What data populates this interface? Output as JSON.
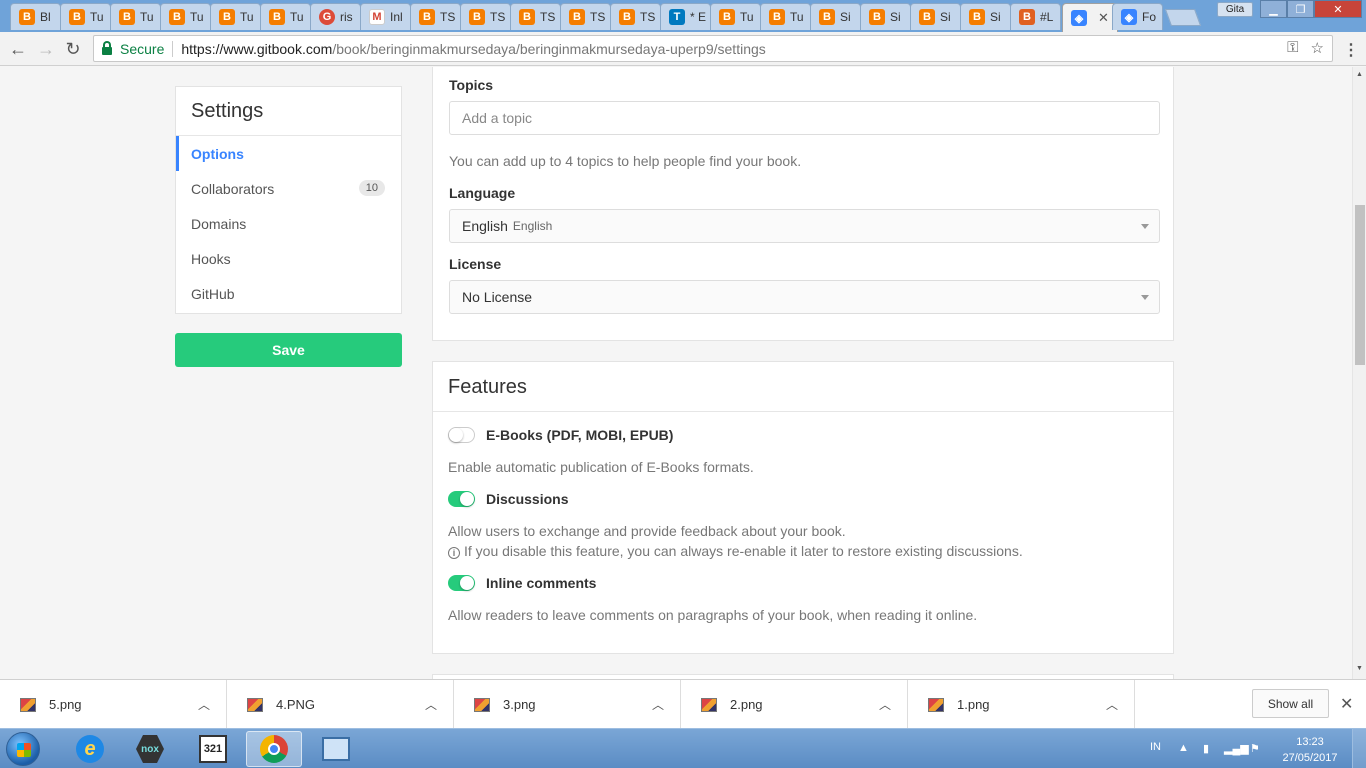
{
  "browser": {
    "tabs": [
      {
        "label": "Bl",
        "icon": "blogger-icon"
      },
      {
        "label": "Tu",
        "icon": "blogger-icon"
      },
      {
        "label": "Tu",
        "icon": "blogger-icon"
      },
      {
        "label": "Tu",
        "icon": "blogger-icon"
      },
      {
        "label": "Tu",
        "icon": "blogger-icon"
      },
      {
        "label": "Tu",
        "icon": "blogger-icon"
      },
      {
        "label": "ris",
        "icon": "google-plus-icon"
      },
      {
        "label": "Inl",
        "icon": "gmail-icon"
      },
      {
        "label": "TS",
        "icon": "blogger-icon"
      },
      {
        "label": "TS",
        "icon": "blogger-icon"
      },
      {
        "label": "TS",
        "icon": "blogger-icon"
      },
      {
        "label": "TS",
        "icon": "blogger-icon"
      },
      {
        "label": "TS",
        "icon": "blogger-icon"
      },
      {
        "label": "* E",
        "icon": "trello-icon"
      },
      {
        "label": "Tu",
        "icon": "blogger-icon"
      },
      {
        "label": "Tu",
        "icon": "blogger-icon"
      },
      {
        "label": "Si",
        "icon": "blogger-icon"
      },
      {
        "label": "Si",
        "icon": "blogger-icon"
      },
      {
        "label": "Si",
        "icon": "blogger-icon"
      },
      {
        "label": "Si",
        "icon": "blogger-icon"
      },
      {
        "label": "#L",
        "icon": "blogger-icon"
      },
      {
        "label": "",
        "icon": "gitbook-icon",
        "active": true
      },
      {
        "label": "Fo",
        "icon": "gitbook-icon"
      }
    ],
    "profile_name": "Gita",
    "secure_label": "Secure",
    "url_host": "https://www.gitbook.com",
    "url_path": "/book/beringinmakmursedaya/beringinmakmursedaya-uperp9/settings"
  },
  "sidebar": {
    "title": "Settings",
    "items": [
      {
        "label": "Options",
        "active": true
      },
      {
        "label": "Collaborators",
        "badge": "10"
      },
      {
        "label": "Domains"
      },
      {
        "label": "Hooks"
      },
      {
        "label": "GitHub"
      }
    ],
    "save_label": "Save"
  },
  "general": {
    "topics_label": "Topics",
    "topics_placeholder": "Add a topic",
    "topics_help": "You can add up to 4 topics to help people find your book.",
    "language_label": "Language",
    "language_value": "English",
    "language_native": "English",
    "license_label": "License",
    "license_value": "No License"
  },
  "features": {
    "title": "Features",
    "items": [
      {
        "label": "E-Books (PDF, MOBI, EPUB)",
        "enabled": false,
        "desc": "Enable automatic publication of E-Books formats."
      },
      {
        "label": "Discussions",
        "enabled": true,
        "desc": "Allow users to exchange and provide feedback about your book.",
        "note": "If you disable this feature, you can always re-enable it later to restore existing discussions."
      },
      {
        "label": "Inline comments",
        "enabled": true,
        "desc": "Allow readers to leave comments on paragraphs of your book, when reading it online."
      }
    ]
  },
  "downloads": {
    "items": [
      "5.png",
      "4.PNG",
      "3.png",
      "2.png",
      "1.png"
    ],
    "show_all_label": "Show all"
  },
  "taskbar": {
    "language": "IN",
    "time": "13:23",
    "date": "27/05/2017",
    "apps": [
      "internet-explorer-icon",
      "nox-icon",
      "media-player-icon",
      "chrome-icon",
      "remote-desktop-icon"
    ],
    "mpc_text": "321"
  },
  "colors": {
    "accent": "#3884ff",
    "success": "#26cb7c"
  }
}
